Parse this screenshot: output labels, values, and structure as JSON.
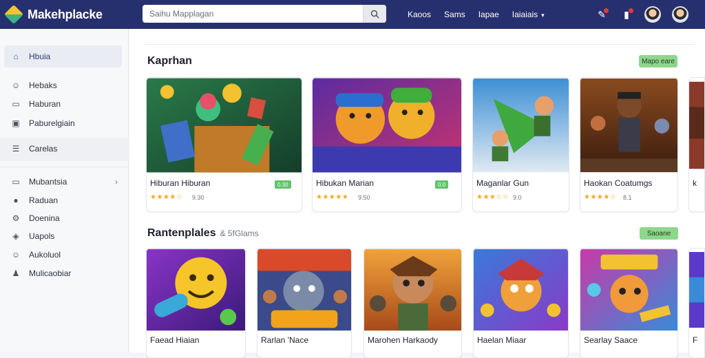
{
  "app": {
    "name": "Makehplacke"
  },
  "search": {
    "placeholder": "Saihu Mapplagan"
  },
  "nav": [
    "Kaoos",
    "Sams",
    "Iapae",
    "Iaiaiais"
  ],
  "sidebar": {
    "items": [
      {
        "label": "Hbuia",
        "icon": "home-icon",
        "active": true
      },
      {
        "label": "Hebaks",
        "icon": "user-icon"
      },
      {
        "label": "Haburan",
        "icon": "folder-icon"
      },
      {
        "label": "Paburelgiain",
        "icon": "image-icon"
      },
      {
        "label": "Carelas",
        "icon": "list-icon"
      },
      {
        "label": "Mubantsia",
        "icon": "folder-icon",
        "arrow": true
      },
      {
        "label": "Raduan",
        "icon": "circle-icon"
      },
      {
        "label": "Doenina",
        "icon": "gear-icon"
      },
      {
        "label": "Uapols",
        "icon": "shield-icon"
      },
      {
        "label": "Aukoluol",
        "icon": "user-icon"
      },
      {
        "label": "Mulicaobiar",
        "icon": "person-icon"
      }
    ]
  },
  "sections": [
    {
      "title": "Kaprhan",
      "subtitle": "",
      "action": "Mapo eare"
    },
    {
      "title": "Rantenplales",
      "subtitle": "& 5fGlams",
      "action": "Saoane"
    }
  ],
  "row1": [
    {
      "title": "Hiburan Hiburan",
      "stars": "★★★★☆",
      "rating": "9.30",
      "badge": "0.30"
    },
    {
      "title": "Hibukan Marian",
      "stars": "★★★★★",
      "rating": "9.50",
      "badge": "0.0"
    },
    {
      "title": "Maganlar Gun",
      "stars": "★★★☆☆",
      "rating": "9.0",
      "badge": ""
    },
    {
      "title": "Haokan Coatumgs",
      "stars": "★★★★☆",
      "rating": "8.1",
      "badge": ""
    }
  ],
  "row2": [
    {
      "title": "Faead Hiaian"
    },
    {
      "title": "Rarlan 'Nace"
    },
    {
      "title": "Marohen Harkaody"
    },
    {
      "title": "Haelan Miaar"
    },
    {
      "title": "Searlay Saace"
    }
  ],
  "card_edge_labels": [
    "F",
    "k"
  ],
  "colors": {
    "topbar": "#27306e",
    "accent": "#3b55c4",
    "pill": "#8ed68c",
    "star": "#f2a71b"
  }
}
